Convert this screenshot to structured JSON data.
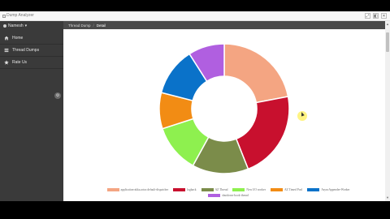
{
  "app": {
    "title": "Dump Analyzer"
  },
  "window_controls": [
    "minimize",
    "maximize",
    "close"
  ],
  "sidebar": {
    "user_label": "Namesh",
    "items": [
      {
        "label": "Home",
        "icon": "home-icon"
      },
      {
        "label": "Thread Dumps",
        "icon": "list-icon"
      },
      {
        "label": "Rate Us",
        "icon": "star-icon"
      }
    ]
  },
  "breadcrumb": {
    "items": [
      "Thread Dump",
      "Detail"
    ],
    "separator": "/"
  },
  "chart_data": {
    "type": "pie",
    "series": [
      {
        "name": "application-akka.actor.default-dispatcher",
        "value": 22,
        "color": "#f4a582"
      },
      {
        "name": "logback",
        "value": 22,
        "color": "#c8102e"
      },
      {
        "name": "AZ Thread",
        "value": 14,
        "color": "#7b8c4a"
      },
      {
        "name": "New I/O worker",
        "value": 12,
        "color": "#8ef04f"
      },
      {
        "name": "AZ Timed Pool",
        "value": 9,
        "color": "#f28c14"
      },
      {
        "name": "AsyncAppender-Worker",
        "value": 12,
        "color": "#0a72c9"
      },
      {
        "name": "shutdown-hook-thread",
        "value": 9,
        "color": "#b05fe0"
      }
    ]
  }
}
